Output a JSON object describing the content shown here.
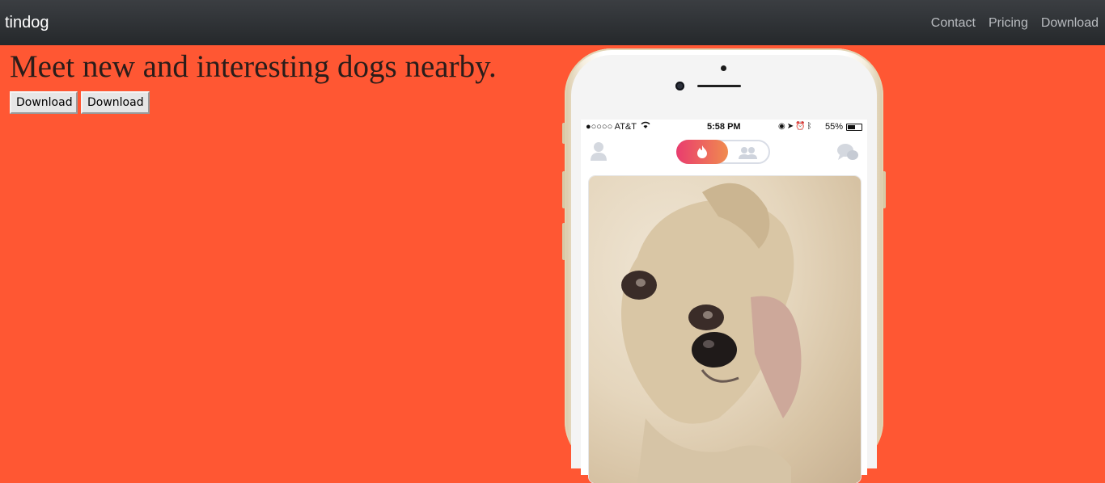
{
  "navbar": {
    "brand": "tindog",
    "links": [
      "Contact",
      "Pricing",
      "Download"
    ]
  },
  "hero": {
    "title": "Meet new and interesting dogs nearby.",
    "buttons": [
      "Download",
      "Download"
    ]
  },
  "phone": {
    "status_bar": {
      "carrier": "●○○○○ AT&T",
      "time": "5:58 PM",
      "battery": "55%"
    },
    "icons": [
      "profile-icon",
      "flame-icon",
      "people-icon",
      "chat-icon"
    ]
  },
  "colors": {
    "background": "#ff5733",
    "navbar": "#2f3236",
    "toggle_gradient_start": "#e93c6e",
    "toggle_gradient_end": "#f08b4f"
  }
}
